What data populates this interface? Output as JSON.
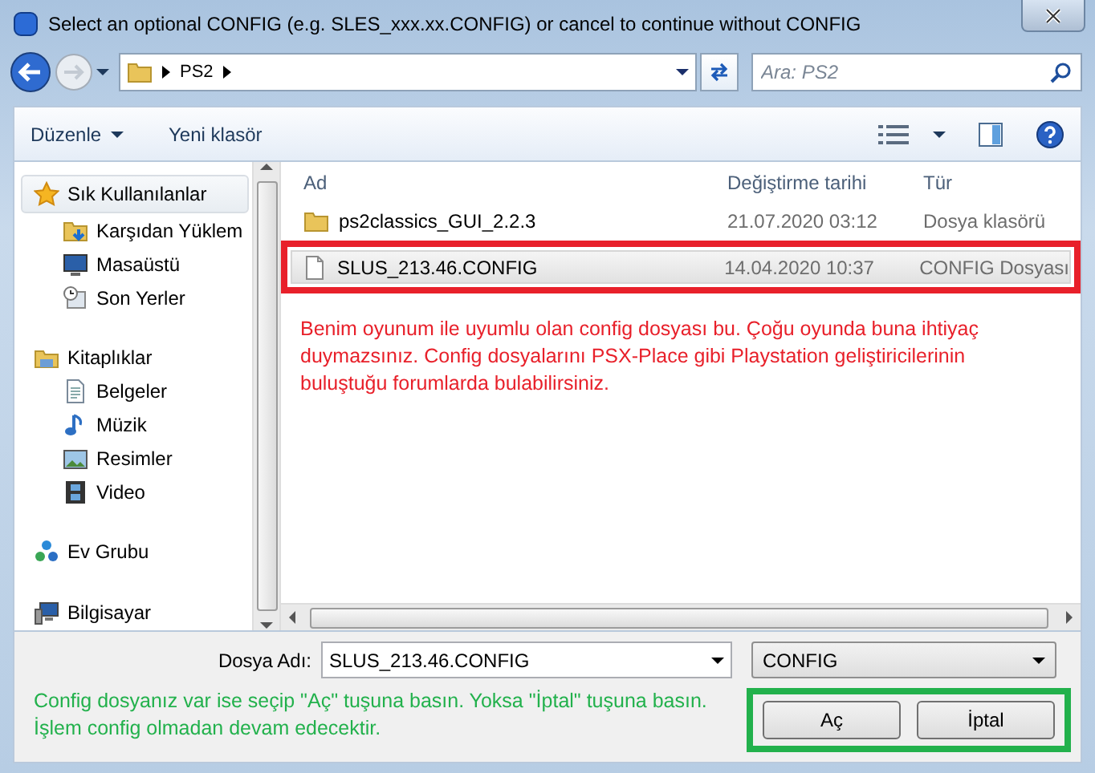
{
  "window": {
    "title": "Select an optional CONFIG (e.g. SLES_xxx.xx.CONFIG) or cancel to continue without CONFIG"
  },
  "address": {
    "path": [
      "PS2"
    ]
  },
  "search": {
    "placeholder": "Ara: PS2"
  },
  "toolbar": {
    "items": [
      "Düzenle",
      "Yeni klasör"
    ]
  },
  "sidebar": {
    "groups": [
      {
        "label": "Sık Kullanılanlar",
        "kind": "star",
        "selected": true,
        "children": [
          {
            "label": "Karşıdan Yüklem",
            "kind": "download"
          },
          {
            "label": "Masaüstü",
            "kind": "desktop"
          },
          {
            "label": "Son Yerler",
            "kind": "recent"
          }
        ]
      },
      {
        "label": "Kitaplıklar",
        "kind": "library",
        "selected": false,
        "children": [
          {
            "label": "Belgeler",
            "kind": "document"
          },
          {
            "label": "Müzik",
            "kind": "music"
          },
          {
            "label": "Resimler",
            "kind": "pictures"
          },
          {
            "label": "Video",
            "kind": "video"
          }
        ]
      },
      {
        "label": "Ev Grubu",
        "kind": "homegroup",
        "selected": false
      },
      {
        "label": "Bilgisayar",
        "kind": "computer",
        "selected": false
      }
    ]
  },
  "files": {
    "columns": [
      "Ad",
      "Değiştirme tarihi",
      "Tür"
    ],
    "rows": [
      {
        "kind": "folder",
        "name": "ps2classics_GUI_2.2.3",
        "date": "21.07.2020 03:12",
        "type": "Dosya klasörü",
        "selected": false,
        "outlined": false
      },
      {
        "kind": "file",
        "name": "SLUS_213.46.CONFIG",
        "date": "14.04.2020 10:37",
        "type": "CONFIG Dosyası",
        "selected": true,
        "outlined": true
      }
    ]
  },
  "note": "Benim oyunum ile uyumlu olan config dosyası bu. Çoğu oyunda buna ihtiyaç duymazsınız. Config dosyalarını PSX-Place gibi Playstation geliştiricilerinin buluştuğu forumlarda bulabilirsiniz.",
  "footer": {
    "filename_label": "Dosya Adı:",
    "filename": "SLUS_213.46.CONFIG",
    "filter": "CONFIG",
    "buttons": [
      "Aç",
      "İptal"
    ],
    "buttons_outlined": true,
    "note": "Config dosyanız var ise seçip \"Aç\" tuşuna basın. Yoksa \"İptal\" tuşuna basın. İşlem config olmadan devam edecektir."
  }
}
